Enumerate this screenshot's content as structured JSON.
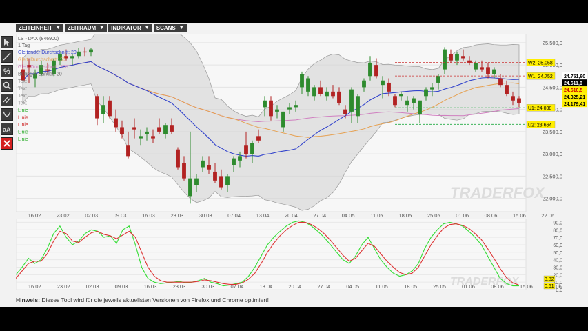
{
  "toolbar": {
    "items": [
      {
        "label": "ZEITEINHEIT"
      },
      {
        "label": "ZEITRAUM"
      },
      {
        "label": "INDIKATOR"
      },
      {
        "label": "SCANS"
      }
    ]
  },
  "tools": [
    {
      "icon": "cursor-icon"
    },
    {
      "icon": "line-draw-icon"
    },
    {
      "icon": "percent-icon"
    },
    {
      "icon": "zoom-icon"
    },
    {
      "icon": "parallel-lines-icon"
    },
    {
      "icon": "arc-icon"
    },
    {
      "icon": "text-size-icon"
    },
    {
      "icon": "delete-icon"
    }
  ],
  "colors": {
    "up_candle": "#2e8b2e",
    "down_candle": "#b22222",
    "bollinger_fill": "#d4d4d4",
    "sma20": "#3344cc",
    "ema": "#e6a050",
    "long_ma": "#d080c0",
    "stoch_k": "#33dd33",
    "stoch_d": "#dd3333",
    "resistance": "#cc3333",
    "support": "#22aa44"
  },
  "legend": {
    "symbol": "LS - DAX (846900)",
    "timeframe": "1 Tag",
    "lines": [
      {
        "text": "Gleitender Durchschnitt: 20",
        "color": "#3344cc"
      },
      {
        "text": "Gleit. Durchschnitt: 50",
        "color": "#e6a050"
      },
      {
        "text": "Gleit. Durchschnitt: 200",
        "color": "#d080c0"
      },
      {
        "text": "Bollinger-Bänder: 20",
        "color": "#666666"
      },
      {
        "text": "Text",
        "color": "#888888"
      },
      {
        "text": "Text",
        "color": "#888888"
      },
      {
        "text": "Text",
        "color": "#888888"
      },
      {
        "text": "Text",
        "color": "#888888"
      },
      {
        "text": "Linie",
        "color": "#22aa22"
      },
      {
        "text": "Linie",
        "color": "#cc2222"
      },
      {
        "text": "Linie",
        "color": "#cc2222"
      },
      {
        "text": "Linie",
        "color": "#22aa22"
      },
      {
        "text": "Linie",
        "color": "#22aa22"
      }
    ]
  },
  "watermark": "TRADERFOX",
  "chart_data": [
    {
      "type": "candlestick",
      "title": "LS - DAX (846900)",
      "x_ticks": [
        "16.02.",
        "23.02.",
        "02.03.",
        "09.03.",
        "16.03.",
        "23.03.",
        "30.03.",
        "07.04.",
        "13.04.",
        "20.04.",
        "27.04.",
        "04.05.",
        "11.05.",
        "18.05.",
        "25.05.",
        "01.06.",
        "08.06.",
        "15.06.",
        "22.06."
      ],
      "y_ticks": [
        22000,
        22500,
        23000,
        23500,
        24000,
        24500,
        25000,
        25500
      ],
      "y_tick_labels": [
        "22.000,0",
        "22.500,0",
        "23.000,0",
        "23.500,0",
        "24.000,0",
        "24.500,0",
        "25.000,0",
        "25.500,0"
      ],
      "ylim": [
        21700,
        25700
      ],
      "candles": [
        [
          24900,
          25100,
          24700,
          24650
        ],
        [
          25000,
          25150,
          24600,
          24950
        ],
        [
          24700,
          24900,
          24500,
          24800
        ],
        [
          24800,
          25100,
          24750,
          25000
        ],
        [
          24900,
          25050,
          24800,
          24870
        ],
        [
          24800,
          25150,
          24750,
          25100
        ],
        [
          25100,
          25300,
          25000,
          25250
        ],
        [
          25200,
          25350,
          25100,
          25150
        ],
        [
          25150,
          25250,
          25000,
          25200
        ],
        [
          25200,
          25380,
          25150,
          25300
        ],
        [
          25300,
          25400,
          25200,
          25280
        ],
        [
          25280,
          25380,
          25200,
          25350
        ],
        [
          24300,
          24350,
          23650,
          23800
        ],
        [
          23900,
          24300,
          23700,
          24100
        ],
        [
          24200,
          24300,
          23800,
          23850
        ],
        [
          23800,
          24000,
          23500,
          23600
        ],
        [
          23600,
          23750,
          23350,
          23450
        ],
        [
          23200,
          23500,
          22900,
          22950
        ],
        [
          23600,
          23800,
          23350,
          23550
        ],
        [
          23350,
          23550,
          23200,
          23400
        ],
        [
          23450,
          23600,
          23300,
          23500
        ],
        [
          23400,
          23550,
          23250,
          23350
        ],
        [
          23600,
          23800,
          23450,
          23500
        ],
        [
          23450,
          23700,
          23350,
          23650
        ],
        [
          23650,
          23800,
          23450,
          23500
        ],
        [
          23100,
          23150,
          22650,
          22700
        ],
        [
          22800,
          22950,
          22400,
          22450
        ],
        [
          22050,
          23500,
          21880,
          22450
        ],
        [
          22300,
          22550,
          22150,
          22450
        ],
        [
          22700,
          22950,
          22600,
          22850
        ],
        [
          22750,
          22950,
          22550,
          22650
        ],
        [
          22600,
          22800,
          22350,
          22400
        ],
        [
          22500,
          22650,
          22200,
          22250
        ],
        [
          22300,
          22550,
          22150,
          22500
        ],
        [
          22750,
          22950,
          22600,
          22900
        ],
        [
          22850,
          23050,
          22700,
          22950
        ],
        [
          23200,
          23500,
          22900,
          23000
        ],
        [
          23000,
          23300,
          22800,
          23250
        ],
        [
          23400,
          23550,
          23250,
          23300
        ],
        [
          24050,
          24300,
          23850,
          24200
        ],
        [
          24200,
          24300,
          23750,
          23850
        ],
        [
          23950,
          24100,
          23800,
          24000
        ],
        [
          23600,
          23950,
          23500,
          23950
        ],
        [
          24000,
          24150,
          23900,
          24050
        ],
        [
          24050,
          24200,
          23950,
          24100
        ],
        [
          24500,
          24850,
          24350,
          24800
        ],
        [
          24400,
          24750,
          24300,
          24700
        ],
        [
          24300,
          24550,
          24200,
          24500
        ],
        [
          24500,
          24650,
          24300,
          24350
        ],
        [
          24300,
          24500,
          24200,
          24400
        ],
        [
          24400,
          24550,
          24250,
          24300
        ],
        [
          24400,
          24500,
          24100,
          24150
        ],
        [
          24000,
          24100,
          23800,
          23900
        ],
        [
          23950,
          24500,
          23700,
          24450
        ],
        [
          23850,
          24350,
          23700,
          24300
        ],
        [
          24500,
          24700,
          24400,
          24650
        ],
        [
          24750,
          25200,
          24650,
          25050
        ],
        [
          25000,
          25150,
          24700,
          24750
        ],
        [
          24550,
          24750,
          24250,
          24650
        ],
        [
          24600,
          24700,
          24300,
          24400
        ],
        [
          24300,
          24350,
          24050,
          24100
        ],
        [
          24300,
          24400,
          24200,
          24350
        ],
        [
          24100,
          24300,
          23950,
          24200
        ],
        [
          24150,
          24300,
          24000,
          24250
        ],
        [
          23900,
          24200,
          23700,
          24200
        ],
        [
          24300,
          24500,
          24200,
          24450
        ],
        [
          24450,
          24600,
          24300,
          24500
        ],
        [
          24600,
          24800,
          24450,
          24750
        ],
        [
          24900,
          25400,
          24800,
          25350
        ],
        [
          25250,
          25350,
          25050,
          25100
        ],
        [
          25100,
          25300,
          25000,
          25250
        ],
        [
          25200,
          25350,
          25100,
          25150
        ],
        [
          25100,
          25200,
          25000,
          25050
        ],
        [
          24900,
          25100,
          24850,
          25050
        ],
        [
          24950,
          25100,
          24850,
          24900
        ],
        [
          24950,
          25050,
          24700,
          24800
        ],
        [
          24800,
          24950,
          24700,
          24900
        ],
        [
          24700,
          24800,
          24500,
          24550
        ],
        [
          24550,
          24650,
          24300,
          24350
        ],
        [
          24300,
          24400,
          24100,
          24200
        ],
        [
          24250,
          24300,
          24050,
          24150
        ]
      ],
      "price_badges": [
        {
          "text": "W2: 25.058",
          "value": 25058,
          "kind": "resistance"
        },
        {
          "text": "W1: 24.752",
          "value": 24752,
          "kind": "resistance"
        },
        {
          "text": "U1: 24.038",
          "value": 24038,
          "kind": "support"
        },
        {
          "text": "U2: 23.664",
          "value": 23664,
          "kind": "support"
        }
      ],
      "value_labels": [
        {
          "text": "24.751,60",
          "value": 24751.6,
          "bg": "#ffffff",
          "fg": "#000000"
        },
        {
          "text": "24.611,0",
          "value": 24611,
          "bg": "#000000",
          "fg": "#ffffff"
        },
        {
          "text": "24.610,5",
          "value": 24610.5,
          "bg": "#ffee00",
          "fg": "#cc0000"
        },
        {
          "text": "24.325,21",
          "value": 24325.21,
          "bg": "#ffee00",
          "fg": "#000000"
        },
        {
          "text": "24.179,41",
          "value": 24179.41,
          "bg": "#ffee00",
          "fg": "#000000"
        }
      ]
    },
    {
      "type": "line",
      "title": "",
      "x_ticks": [
        "16.02.",
        "23.02.",
        "02.03.",
        "09.03.",
        "16.03.",
        "23.03.",
        "30.03.",
        "07.04.",
        "13.04.",
        "20.04.",
        "27.04.",
        "04.05.",
        "11.05.",
        "18.05.",
        "25.05.",
        "01.06.",
        "08.06.",
        "15.06.",
        "22.06."
      ],
      "y_ticks": [
        0,
        10,
        20,
        30,
        40,
        50,
        60,
        70,
        80,
        90
      ],
      "y_tick_labels": [
        "0,0",
        "10,0",
        "20,0",
        "30,0",
        "40,0",
        "50,0",
        "60,0",
        "70,0",
        "80,0",
        "90,0"
      ],
      "ylim": [
        0,
        95
      ],
      "series": [
        {
          "name": "",
          "color": "#33dd33",
          "values": [
            20,
            30,
            42,
            35,
            40,
            55,
            75,
            85,
            70,
            60,
            65,
            75,
            80,
            78,
            70,
            72,
            62,
            80,
            85,
            60,
            30,
            15,
            10,
            8,
            9,
            10,
            11,
            9,
            10,
            12,
            15,
            10,
            8,
            5,
            6,
            8,
            10,
            18,
            30,
            45,
            60,
            70,
            78,
            85,
            90,
            92,
            90,
            85,
            78,
            70,
            60,
            50,
            40,
            35,
            45,
            60,
            70,
            55,
            40,
            30,
            22,
            18,
            20,
            25,
            35,
            55,
            70,
            80,
            88,
            90,
            88,
            85,
            78,
            70,
            60,
            45,
            30,
            15,
            8,
            5,
            5
          ]
        },
        {
          "name": "",
          "color": "#dd3333",
          "values": [
            15,
            25,
            35,
            38,
            38,
            48,
            65,
            78,
            75,
            65,
            63,
            70,
            76,
            78,
            74,
            72,
            68,
            73,
            78,
            70,
            50,
            30,
            18,
            12,
            10,
            10,
            10,
            10,
            10,
            11,
            13,
            12,
            10,
            8,
            7,
            7,
            9,
            14,
            22,
            35,
            50,
            62,
            72,
            80,
            86,
            90,
            90,
            87,
            82,
            75,
            66,
            56,
            46,
            38,
            42,
            52,
            62,
            58,
            48,
            38,
            30,
            23,
            20,
            22,
            30,
            45,
            60,
            72,
            82,
            87,
            88,
            86,
            82,
            75,
            67,
            55,
            42,
            28,
            16,
            9,
            6
          ]
        }
      ],
      "end_labels": [
        {
          "text": "3,82",
          "value": 3.82
        },
        {
          "text": "0,61",
          "value": 0.61
        }
      ]
    }
  ],
  "hint": {
    "bold": "Hinweis:",
    "text": "Dieses Tool wird für die jeweils aktuellsten Versionen von Firefox und Chrome optimiert!"
  }
}
